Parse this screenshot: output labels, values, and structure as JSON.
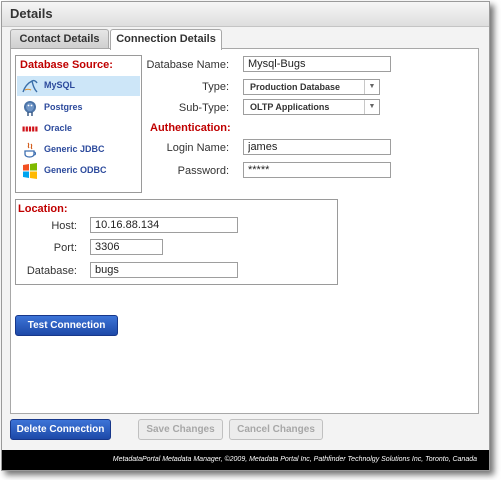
{
  "window": {
    "title": "Details"
  },
  "tabs": [
    {
      "label": "Contact Details"
    },
    {
      "label": "Connection Details"
    }
  ],
  "database_source": {
    "heading": "Database Source:",
    "items": [
      {
        "label": "MySQL",
        "icon": "mysql-icon",
        "selected": true
      },
      {
        "label": "Postgres",
        "icon": "postgres-icon"
      },
      {
        "label": "Oracle",
        "icon": "oracle-icon"
      },
      {
        "label": "Generic JDBC",
        "icon": "jdbc-icon"
      },
      {
        "label": "Generic ODBC",
        "icon": "odbc-icon"
      }
    ]
  },
  "connection": {
    "database_name_label": "Database Name:",
    "database_name_value": "Mysql-Bugs",
    "type_label": "Type:",
    "type_value": "Production Database",
    "subtype_label": "Sub-Type:",
    "subtype_value": "OLTP Applications"
  },
  "authentication": {
    "heading": "Authentication:",
    "login_label": "Login Name:",
    "login_value": "james",
    "password_label": "Password:",
    "password_value": "*****"
  },
  "location": {
    "heading": "Location:",
    "host_label": "Host:",
    "host_value": "10.16.88.134",
    "port_label": "Port:",
    "port_value": "3306",
    "database_label": "Database:",
    "database_value": "bugs"
  },
  "buttons": {
    "test_connection": "Test Connection",
    "delete_connection": "Delete Connection",
    "save_changes": "Save Changes",
    "cancel_changes": "Cancel Changes"
  },
  "footer": {
    "text": "MetadataPortal Metadata Manager, ©2009, Metadata Portal Inc, Pathfinder Technolgy Solutions Inc, Toronto, Canada"
  },
  "colors": {
    "section_heading": "#c00000",
    "list_text": "#2c4a9c",
    "selected_row": "#cde6f8",
    "primary_button": "#2456bd"
  }
}
